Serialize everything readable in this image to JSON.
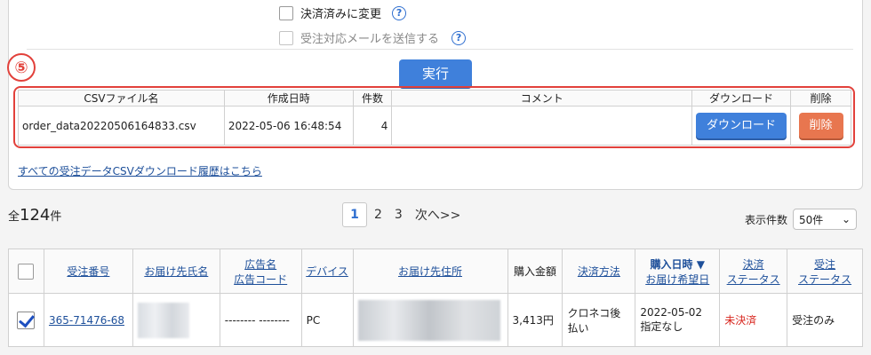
{
  "options": {
    "settled_label": "決済済みに変更",
    "send_mail_label": "受注対応メールを送信する",
    "help_glyph": "?"
  },
  "step_marker": "⑤",
  "exec_label": "実行",
  "csv_table": {
    "headers": [
      "CSVファイル名",
      "作成日時",
      "件数",
      "コメント",
      "ダウンロード",
      "削除"
    ],
    "row": {
      "filename": "order_data20220506164833.csv",
      "created": "2022-05-06 16:48:54",
      "count": "4",
      "comment": "",
      "download_label": "ダウンロード",
      "delete_label": "削除"
    }
  },
  "history_link": "すべての受注データCSVダウンロード履歴はこちら",
  "total": {
    "prefix": "全",
    "count": "124",
    "suffix": "件"
  },
  "pager": {
    "current": "1",
    "p2": "2",
    "p3": "3",
    "next": "次へ>>"
  },
  "per_page": {
    "label": "表示件数",
    "value": "50件"
  },
  "orders": {
    "headers": {
      "order_no": "受注番号",
      "recipient": "お届け先氏名",
      "ad_line1": "広告名",
      "ad_line2": "広告コード",
      "device": "デバイス",
      "address": "お届け先住所",
      "amount": "購入金額",
      "payment": "決済方法",
      "date_line1": "購入日時 ▼",
      "date_line2": "お届け希望日",
      "pay_status_line1": "決済",
      "pay_status_line2": "ステータス",
      "order_status_line1": "受注",
      "order_status_line2": "ステータス"
    },
    "rows": [
      {
        "order_no": "365-71476-68",
        "ad": "-------- --------",
        "device": "PC",
        "amount": "3,413円",
        "payment": "クロネコ後払い",
        "date": "2022-05-02",
        "delivery": "指定なし",
        "pay_status": "未決済",
        "order_status": "受注のみ"
      }
    ]
  },
  "colors": {
    "accent": "#3f80db",
    "danger": "#e8764f",
    "highlight": "#e2413b"
  }
}
